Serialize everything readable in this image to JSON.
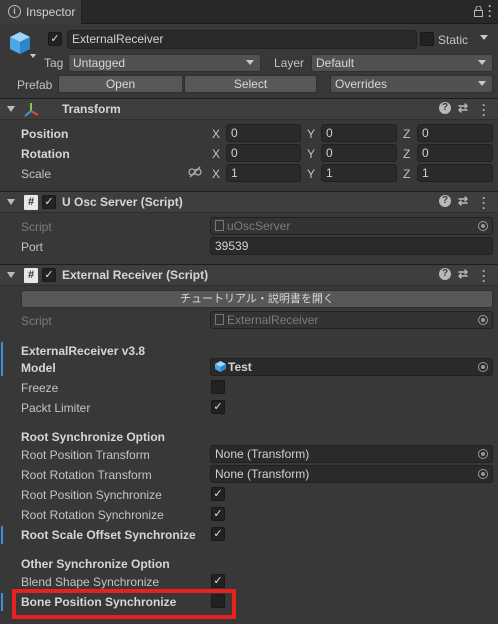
{
  "tab": {
    "label": "Inspector"
  },
  "gameobject": {
    "active": true,
    "name": "ExternalReceiver",
    "static_label": "Static",
    "static": false,
    "tag_label": "Tag",
    "tag_value": "Untagged",
    "layer_label": "Layer",
    "layer_value": "Default",
    "prefab_label": "Prefab",
    "open_label": "Open",
    "select_label": "Select",
    "overrides_label": "Overrides"
  },
  "transform": {
    "title": "Transform",
    "rows": [
      {
        "label": "Position",
        "x": "0",
        "y": "0",
        "z": "0"
      },
      {
        "label": "Rotation",
        "x": "0",
        "y": "0",
        "z": "0"
      },
      {
        "label": "Scale",
        "x": "1",
        "y": "1",
        "z": "1"
      }
    ],
    "axis_x": "X",
    "axis_y": "Y",
    "axis_z": "Z"
  },
  "osc_server": {
    "title": "U Osc Server (Script)",
    "enabled": true,
    "script_label": "Script",
    "script_value": "uOscServer",
    "port_label": "Port",
    "port_value": "39539"
  },
  "external_receiver": {
    "title": "External Receiver (Script)",
    "enabled": true,
    "tutorial_button": "チュートリアル・説明書を開く",
    "script_label": "Script",
    "script_value": "ExternalReceiver",
    "version_heading": "ExternalReceiver v3.8",
    "model_label": "Model",
    "model_value": "Test",
    "freeze_label": "Freeze",
    "freeze": false,
    "packt_limiter_label": "Packt Limiter",
    "packt_limiter": true,
    "root_heading": "Root Synchronize Option",
    "root_position_transform_label": "Root Position Transform",
    "root_position_transform_value": "None (Transform)",
    "root_rotation_transform_label": "Root Rotation Transform",
    "root_rotation_transform_value": "None (Transform)",
    "root_position_sync_label": "Root Position Synchronize",
    "root_position_sync": true,
    "root_rotation_sync_label": "Root Rotation Synchronize",
    "root_rotation_sync": true,
    "root_scale_offset_sync_label": "Root Scale Offset Synchronize",
    "root_scale_offset_sync": true,
    "other_heading": "Other Synchronize Option",
    "blend_shape_sync_label": "Blend Shape Synchronize",
    "blend_shape_sync": true,
    "bone_position_sync_label": "Bone Position Synchronize",
    "bone_position_sync": false
  },
  "colors": {
    "highlight": "#e82020",
    "accent": "#3f8ed8",
    "panel": "#383838"
  }
}
